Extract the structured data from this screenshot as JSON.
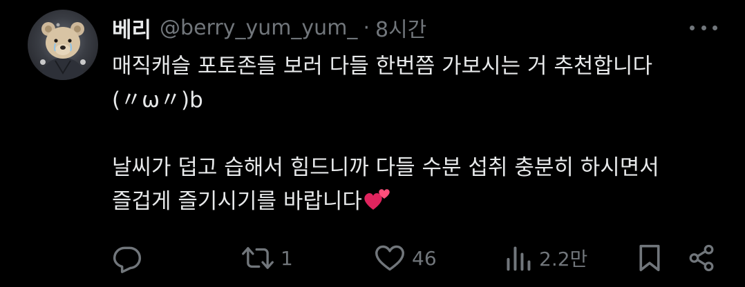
{
  "tweet": {
    "display_name": "베리",
    "handle": "@berry_yum_yum_",
    "separator": "·",
    "time": "8시간",
    "body": {
      "line1": "매직캐슬 포토존들 보러 다들 한번쯤 가보시는 거 추천합니다",
      "line2": "(〃ω〃)b",
      "line3": "날씨가 덥고 습해서 힘드니까 다들 수분 섭취 충분히 하시면서",
      "line4": "즐겁게 즐기시기를 바랍니다",
      "emoji": "two-hearts"
    },
    "actions": {
      "reply_count": "",
      "retweet_count": "1",
      "like_count": "46",
      "views_count": "2.2만"
    }
  },
  "icons": [
    "more-icon",
    "reply-icon",
    "retweet-icon",
    "like-icon",
    "views-icon",
    "bookmark-icon",
    "share-icon",
    "two-hearts-emoji"
  ],
  "colors": {
    "background": "#000000",
    "text": "#e7e9ea",
    "secondary": "#71767b",
    "heart": "#e0245e"
  }
}
